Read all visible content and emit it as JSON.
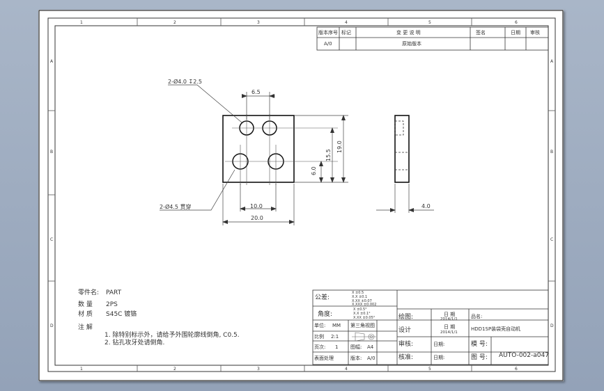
{
  "revision_table": {
    "headers": [
      "版本序号",
      "标记",
      "变 更 说 明",
      "签名",
      "日期",
      "审核"
    ],
    "row": [
      "A/0",
      "",
      "原始版本",
      "",
      "",
      ""
    ]
  },
  "border": {
    "top_labels": [
      "1",
      "2",
      "3",
      "4",
      "5",
      "6"
    ],
    "side_labels": [
      "A",
      "B",
      "C",
      "D"
    ]
  },
  "front_view": {
    "hole_callout_top": "2-Ø4.0 ↧2.5",
    "hole_callout_bottom": "2-Ø4.5 贯穿",
    "dim_hole_spacing": "6.5",
    "dim_hole_offset": "10.0",
    "dim_width": "20.0",
    "dim_height": "19.0",
    "dim_v_1": "15.5",
    "dim_v_2": "6.0"
  },
  "side_view": {
    "dim_thickness": "4.0"
  },
  "part_info": {
    "name_label": "零件名:",
    "name_value": "PART",
    "qty_label": "数 量",
    "qty_value": "2PS",
    "material_label": "材 质",
    "material_value": "S45C 镀铬",
    "notes_label": "注 解",
    "notes": [
      "1. 除特别标示外，请给予外围轮廓线倒角, C0.5.",
      "2. 钻孔攻牙处请倒角."
    ]
  },
  "title_block": {
    "tolerance_label": "公差:",
    "tolerance_values": [
      "X ±0.5",
      "X.X ±0.1",
      "X.XX ±0.07",
      "X.XXX ±0.002"
    ],
    "angle_label": "角度:",
    "angle_values": [
      "X ±0.5°",
      "X.X ±0.1°",
      "X.XX ±0.05°"
    ],
    "unit_label": "单位:",
    "unit_value": "MM",
    "projection": "第三角视图",
    "scale_label": "比例",
    "scale_value": "2:1",
    "pages_label": "页次:",
    "pages_value": "1",
    "paper_label": "图幅:",
    "paper_value": "A4",
    "finish_label": "表面处理",
    "version_label": "版本:",
    "version_value": "A/0",
    "drawn_label": "绘图:",
    "design_label": "设计",
    "review_label": "审核:",
    "approve_label": "核准:",
    "date_label": "日 期",
    "date_drawn": "2014/1/1",
    "date_design": "2014/1/1",
    "date_short": "日期:",
    "product_label": "品名:",
    "product_value": "HDD1SP装袋壳自动机",
    "model_label": "模 号:",
    "drawing_no_label": "图 号:",
    "drawing_no_value": "AUTO-002-a047"
  }
}
